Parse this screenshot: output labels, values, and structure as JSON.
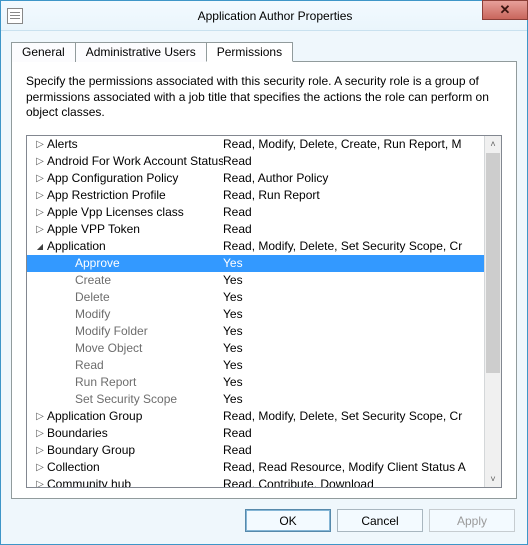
{
  "window": {
    "title": "Application Author Properties"
  },
  "tabs": [
    {
      "label": "General"
    },
    {
      "label": "Administrative Users"
    },
    {
      "label": "Permissions"
    }
  ],
  "active_tab": 2,
  "description": "Specify the permissions associated with this security role. A security role is a group of permissions associated with a job title that specifies the actions the role can perform on object classes.",
  "tree": [
    {
      "expand": "closed",
      "level": 0,
      "name": "Alerts",
      "perms": "Read, Modify, Delete, Create, Run Report, M"
    },
    {
      "expand": "closed",
      "level": 0,
      "name": "Android For Work Account Status",
      "perms": "Read"
    },
    {
      "expand": "closed",
      "level": 0,
      "name": "App Configuration Policy",
      "perms": "Read, Author Policy"
    },
    {
      "expand": "closed",
      "level": 0,
      "name": "App Restriction Profile",
      "perms": "Read, Run Report"
    },
    {
      "expand": "closed",
      "level": 0,
      "name": "Apple Vpp Licenses class",
      "perms": "Read"
    },
    {
      "expand": "closed",
      "level": 0,
      "name": "Apple VPP Token",
      "perms": "Read"
    },
    {
      "expand": "open",
      "level": 0,
      "name": "Application",
      "perms": "Read, Modify, Delete, Set Security Scope, Cr"
    },
    {
      "expand": "none",
      "level": 1,
      "name": "Approve",
      "perms": "Yes",
      "selected": true
    },
    {
      "expand": "none",
      "level": 1,
      "name": "Create",
      "perms": "Yes"
    },
    {
      "expand": "none",
      "level": 1,
      "name": "Delete",
      "perms": "Yes"
    },
    {
      "expand": "none",
      "level": 1,
      "name": "Modify",
      "perms": "Yes"
    },
    {
      "expand": "none",
      "level": 1,
      "name": "Modify Folder",
      "perms": "Yes"
    },
    {
      "expand": "none",
      "level": 1,
      "name": "Move Object",
      "perms": "Yes"
    },
    {
      "expand": "none",
      "level": 1,
      "name": "Read",
      "perms": "Yes"
    },
    {
      "expand": "none",
      "level": 1,
      "name": "Run Report",
      "perms": "Yes"
    },
    {
      "expand": "none",
      "level": 1,
      "name": "Set Security Scope",
      "perms": "Yes"
    },
    {
      "expand": "closed",
      "level": 0,
      "name": "Application Group",
      "perms": "Read, Modify, Delete, Set Security Scope, Cr"
    },
    {
      "expand": "closed",
      "level": 0,
      "name": "Boundaries",
      "perms": "Read"
    },
    {
      "expand": "closed",
      "level": 0,
      "name": "Boundary Group",
      "perms": "Read"
    },
    {
      "expand": "closed",
      "level": 0,
      "name": "Collection",
      "perms": "Read, Read Resource, Modify Client Status A"
    },
    {
      "expand": "closed",
      "level": 0,
      "name": "Community hub",
      "perms": "Read, Contribute, Download"
    }
  ],
  "buttons": {
    "ok": "OK",
    "cancel": "Cancel",
    "apply": "Apply"
  }
}
